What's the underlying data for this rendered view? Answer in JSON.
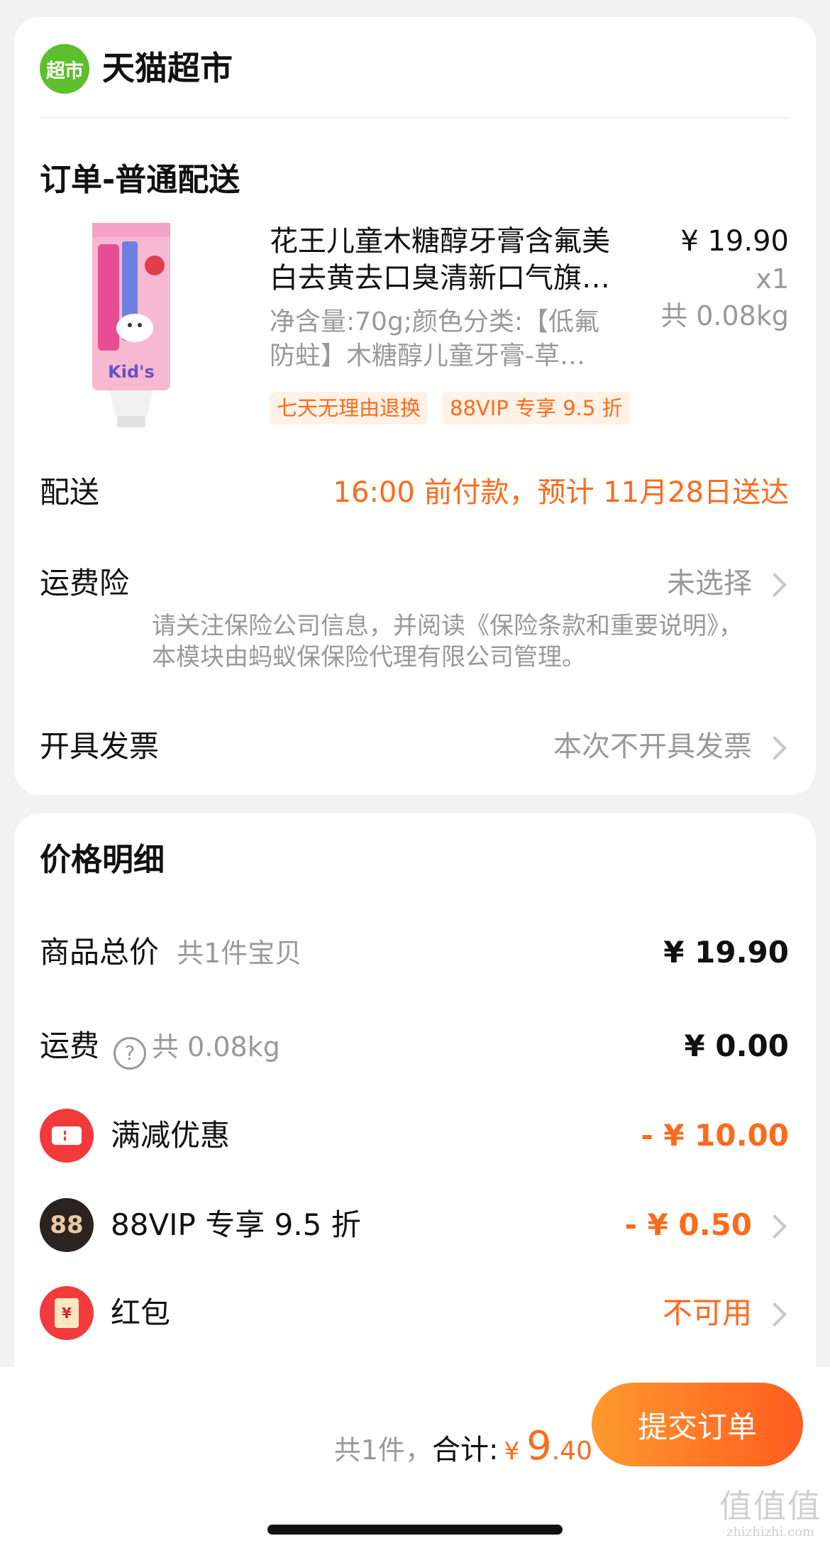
{
  "store": {
    "logo_text": "超市",
    "name": "天猫超市"
  },
  "order": {
    "section_title": "订单-普通配送",
    "product": {
      "title_line1": "花王儿童木糖醇牙膏含氟美",
      "title_line2": "白去黄去口臭清新口气旗…",
      "spec_line1": "净含量:70g;颜色分类:【低氟",
      "spec_line2": "防蛀】木糖醇儿童牙膏-草…",
      "price": "¥ 19.90",
      "quantity": "x1",
      "weight": "共 0.08kg",
      "tags": [
        "七天无理由退换",
        "88VIP 专享 9.5 折"
      ],
      "image_alt": "Kid's toothpaste"
    },
    "delivery": {
      "label": "配送",
      "value": "16:00 前付款，预计 11月28日送达"
    },
    "shipping_insurance": {
      "label": "运费险",
      "value": "未选择",
      "note": "请关注保险公司信息，并阅读《保险条款和重要说明》，本模块由蚂蚁保保险代理有限公司管理。"
    },
    "invoice": {
      "label": "开具发票",
      "value": "本次不开具发票"
    }
  },
  "price_detail": {
    "title": "价格明细",
    "goods_total": {
      "label": "商品总价",
      "sub": "共1件宝贝",
      "value": "¥ 19.90"
    },
    "shipping": {
      "label": "运费",
      "sub": "共 0.08kg",
      "value": "¥ 0.00",
      "help_icon_text": "?"
    },
    "discount": {
      "label": "满减优惠",
      "value": "- ¥ 10.00"
    },
    "vip": {
      "icon_text": "88",
      "label": "88VIP 专享 9.5 折",
      "value": "- ¥ 0.50"
    },
    "red_packet": {
      "icon_text": "¥",
      "label": "红包",
      "value": "不可用"
    }
  },
  "footer": {
    "count_text": "共1件，",
    "total_label": "合计:",
    "currency": "¥",
    "total_int": "9",
    "total_dec": ".40",
    "submit_label": "提交订单"
  },
  "watermark": {
    "mark": "值值值",
    "url": "zhizhizhi.com"
  },
  "colors": {
    "accent": "#ff6a1a",
    "logo_green": "#5cbf2e",
    "discount_red": "#f23a3a",
    "muted": "#999999"
  }
}
